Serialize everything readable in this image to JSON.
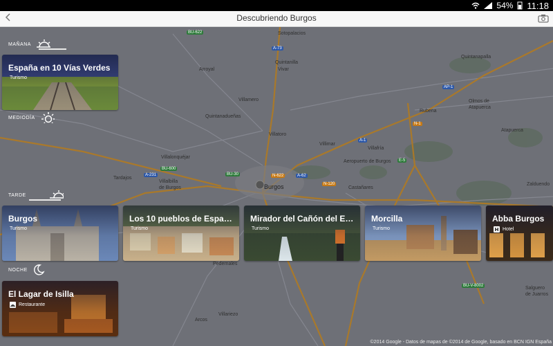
{
  "status": {
    "battery": "54%",
    "time": "11:18"
  },
  "app": {
    "title": "Descubriendo Burgos"
  },
  "sections": {
    "morning": "MAÑANA",
    "midday": "MEDIODÍA",
    "afternoon": "TARDE",
    "night": "NOCHE"
  },
  "cards": {
    "morning_1": {
      "title": "España en 10 Vías Verdes",
      "subtitle": "Turismo"
    },
    "afternoon_1": {
      "title": "Burgos",
      "subtitle": "Turismo"
    },
    "afternoon_2": {
      "title": "Los 10 pueblos de Espan...",
      "subtitle": "Turismo"
    },
    "afternoon_3": {
      "title": "Mirador del Cañón del Eb...",
      "subtitle": "Turismo"
    },
    "afternoon_4": {
      "title": "Morcilla",
      "subtitle": "Turismo"
    },
    "afternoon_5": {
      "title": "Abba Burgos",
      "subtitle": "Hotel"
    },
    "night_1": {
      "title": "El Lagar de Isilla",
      "subtitle": "Restaurante"
    }
  },
  "map": {
    "places": {
      "sotopalacios": "Sotopalacios",
      "quintanilla": "Quintanilla",
      "vivar": "Vivar",
      "arroyal": "Arroyal",
      "quintanapalla": "Quintanapalla",
      "villamero": "Villamero",
      "quintanaduenas": "Quintanadueñas",
      "olmos": "Olmos de",
      "atapuerca": "Atapuerca",
      "rubena": "Rubena",
      "atapuerca2": "Atapuerca",
      "villatoro": "Villatoro",
      "villimar": "Villimar",
      "villafria": "Villafría",
      "aeropuerto": "Aeropuerto de Burgos",
      "villalonquejar": "Villalonquéjar",
      "tardajos": "Tardajos",
      "villalbilla": "Villalbilla",
      "deburgos": "de Burgos",
      "burgos": "Burgos",
      "castanares": "Castañares",
      "zalduendo": "Zalduendo",
      "salguero": "Salguero",
      "dejuarros": "de Juarros",
      "pedernales": "Pedernales",
      "arcos": "Arcos",
      "villariezo": "Villariezo"
    },
    "roads": {
      "bu622": "BU-622",
      "a73": "A-73",
      "ap1": "AP-1",
      "a1": "A-1",
      "n1": "N-1",
      "e5": "E-5",
      "bu600": "BU-600",
      "a231": "A-231",
      "bu30": "BU-30",
      "n120": "N-120",
      "n622": "N-622",
      "a62": "A-62",
      "buv8002": "BU-V-8002"
    },
    "copyright": "©2014 Google - Datos de mapas de ©2014 de Google, basado en BCN IGN España"
  }
}
